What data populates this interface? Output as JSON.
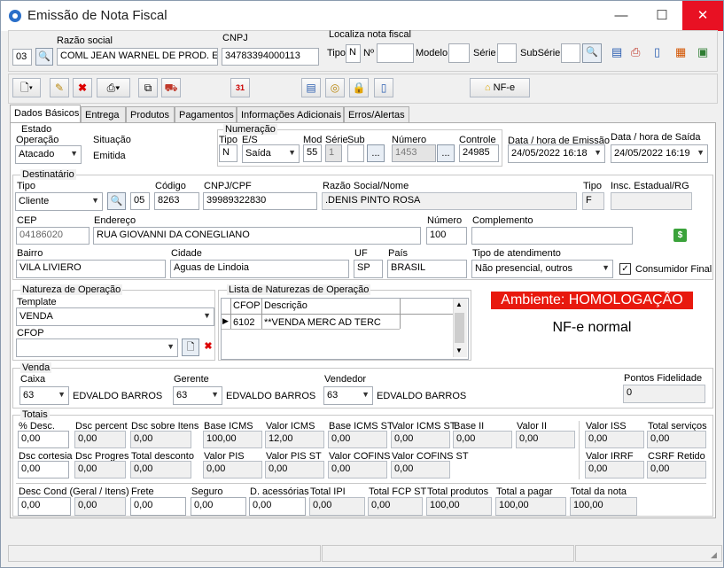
{
  "window": {
    "title": "Emissão de Nota Fiscal",
    "minimize": "—",
    "maximize": "☐",
    "close": "✕"
  },
  "header": {
    "empresa_code": "03",
    "razao_social_label": "Razão social",
    "razao_social": "COML JEAN WARNEL DE PROD. ESP.",
    "cnpj_label": "CNPJ",
    "cnpj": "34783394000113",
    "localiza_title": "Localiza nota fiscal",
    "tipo_label": "Tipo",
    "tipo_value": "N",
    "numero_label": "Nº",
    "modelo_label": "Modelo",
    "serie_label": "Série",
    "subserie_label": "SubSérie"
  },
  "toolbar": {
    "nfe_label": "NF-e",
    "icon_calendar_text": "31"
  },
  "tabs": [
    "Dados Básicos",
    "Entrega",
    "Produtos",
    "Pagamentos",
    "Informações Adicionais",
    "Erros/Alertas"
  ],
  "estado": {
    "title": "Estado",
    "operacao_label": "Operação",
    "operacao": "Atacado",
    "situacao_label": "Situação",
    "situacao": "Emitida"
  },
  "numeracao": {
    "title": "Numeração",
    "tipo_label": "Tipo",
    "tipo": "N",
    "es_label": "E/S",
    "es": "Saída",
    "mod_label": "Mod",
    "mod": "55",
    "serie_label": "Série",
    "serie": "1",
    "sub_label": "Sub",
    "sub": "",
    "numero_label": "Número",
    "numero": "1453",
    "controle_label": "Controle",
    "controle": "24985",
    "dots": "..."
  },
  "datas": {
    "emissao_label": "Data / hora de Emissão",
    "emissao": "24/05/2022 16:18",
    "saida_label": "Data / hora de Saída",
    "saida": "24/05/2022 16:19"
  },
  "destinatario": {
    "title": "Destinatário",
    "tipo_label": "Tipo",
    "tipo": "Cliente",
    "sub_code": "05",
    "codigo_label": "Código",
    "codigo": "8263",
    "cnpj_cpf_label": "CNPJ/CPF",
    "cnpj_cpf": "39989322830",
    "razao_label": "Razão Social/Nome",
    "razao": ".DENIS PINTO ROSA",
    "tipo2_label": "Tipo",
    "tipo2": "F",
    "ie_label": "Insc. Estadual/RG",
    "ie": "",
    "cep_label": "CEP",
    "cep": "04186020",
    "endereco_label": "Endereço",
    "endereco": "RUA GIOVANNI DA CONEGLIANO",
    "numero_label": "Número",
    "numero": "100",
    "complemento_label": "Complemento",
    "complemento": "",
    "bairro_label": "Bairro",
    "bairro": "VILA LIVIERO",
    "cidade_label": "Cidade",
    "cidade": "Aguas de Lindoia",
    "uf_label": "UF",
    "uf": "SP",
    "pais_label": "País",
    "pais": "BRASIL",
    "atendimento_label": "Tipo de atendimento",
    "atendimento": "Não presencial, outros",
    "consumidor_final_label": "Consumidor Final",
    "consumidor_final": true
  },
  "natureza": {
    "title": "Natureza de Operação",
    "template_label": "Template",
    "template": "VENDA",
    "cfop_label": "CFOP",
    "cfop": ""
  },
  "lista_naturezas": {
    "title": "Lista de Naturezas de Operação",
    "columns": [
      "CFOP",
      "Descrição"
    ],
    "rows": [
      {
        "cfop": "6102",
        "descricao": "**VENDA MERC AD TERC"
      }
    ],
    "row_marker": "▶"
  },
  "ambiente": {
    "label": "Ambiente: HOMOLOGAÇÃO",
    "color": "#e8190e",
    "tipo_nfe": "NF-e normal"
  },
  "venda": {
    "title": "Venda",
    "caixa_label": "Caixa",
    "caixa": "63",
    "caixa_nome": "EDVALDO BARROS",
    "gerente_label": "Gerente",
    "gerente": "63",
    "gerente_nome": "EDVALDO BARROS",
    "vendedor_label": "Vendedor",
    "vendedor": "63",
    "vendedor_nome": "EDVALDO BARROS",
    "pontos_label": "Pontos Fidelidade",
    "pontos": "0"
  },
  "totais": {
    "title": "Totais",
    "pct_desc_label": "% Desc.",
    "pct_desc": "0,00",
    "dsc_percent_label": "Dsc percent",
    "dsc_percent": "0,00",
    "dsc_itens_label": "Dsc sobre Itens",
    "dsc_itens": "0,00",
    "base_icms_label": "Base ICMS",
    "base_icms": "100,00",
    "valor_icms_label": "Valor ICMS",
    "valor_icms": "12,00",
    "base_icms_st_label": "Base ICMS ST",
    "base_icms_st": "0,00",
    "valor_icms_st_label": "Valor ICMS ST",
    "valor_icms_st": "0,00",
    "base_ii_label": "Base II",
    "base_ii": "0,00",
    "valor_ii_label": "Valor II",
    "valor_ii": "0,00",
    "valor_iss_label": "Valor ISS",
    "valor_iss": "0,00",
    "total_servicos_label": "Total serviços",
    "total_servicos": "0,00",
    "dsc_cortesia_label": "Dsc cortesia",
    "dsc_cortesia": "0,00",
    "dsc_progres_label": "Dsc Progres",
    "dsc_progres": "0,00",
    "total_desconto_label": "Total desconto",
    "total_desconto": "0,00",
    "valor_pis_label": "Valor PIS",
    "valor_pis": "0,00",
    "valor_pis_st_label": "Valor PIS ST",
    "valor_pis_st": "0,00",
    "valor_cofins_label": "Valor COFINS",
    "valor_cofins": "0,00",
    "valor_cofins_st_label": "Valor COFINS ST",
    "valor_cofins_st": "0,00",
    "valor_irrf_label": "Valor IRRF",
    "valor_irrf": "0,00",
    "csrf_label": "CSRF Retido",
    "csrf": "0,00",
    "desc_cond_label": "Desc Cond (Geral / Itens)",
    "desc_cond_geral": "0,00",
    "desc_cond_itens": "0,00",
    "frete_label": "Frete",
    "frete": "0,00",
    "seguro_label": "Seguro",
    "seguro": "0,00",
    "acessorias_label": "D. acessórias",
    "acessorias": "0,00",
    "total_ipi_label": "Total IPI",
    "total_ipi": "0,00",
    "total_fcp_st_label": "Total FCP ST",
    "total_fcp_st": "0,00",
    "total_produtos_label": "Total produtos",
    "total_produtos": "100,00",
    "total_pagar_label": "Total a pagar",
    "total_pagar": "100,00",
    "total_nota_label": "Total da nota",
    "total_nota": "100,00"
  }
}
